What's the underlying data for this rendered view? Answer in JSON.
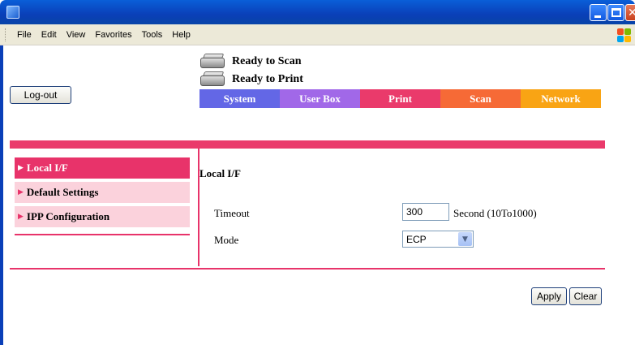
{
  "menu": [
    "File",
    "Edit",
    "View",
    "Favorites",
    "Tools",
    "Help"
  ],
  "status": {
    "scan": "Ready to Scan",
    "print": "Ready to Print"
  },
  "logout_label": "Log-out",
  "tabs": [
    {
      "label": "System",
      "color": "#6367e6"
    },
    {
      "label": "User Box",
      "color": "#a168e8"
    },
    {
      "label": "Print",
      "color": "#ea3a6b"
    },
    {
      "label": "Scan",
      "color": "#f66a36"
    },
    {
      "label": "Network",
      "color": "#f9a414"
    }
  ],
  "sidebar": {
    "items": [
      {
        "label": "Local I/F",
        "active": true
      },
      {
        "label": "Default Settings",
        "active": false
      },
      {
        "label": "IPP Configuration",
        "active": false
      }
    ]
  },
  "main": {
    "title": "Local I/F",
    "timeout_label": "Timeout",
    "timeout_value": "300",
    "timeout_unit": "Second (10To1000)",
    "mode_label": "Mode",
    "mode_value": "ECP"
  },
  "actions": {
    "apply": "Apply",
    "clear": "Clear"
  },
  "colors": {
    "accent": "#e8336a",
    "accent_light": "#fbd2dc"
  }
}
